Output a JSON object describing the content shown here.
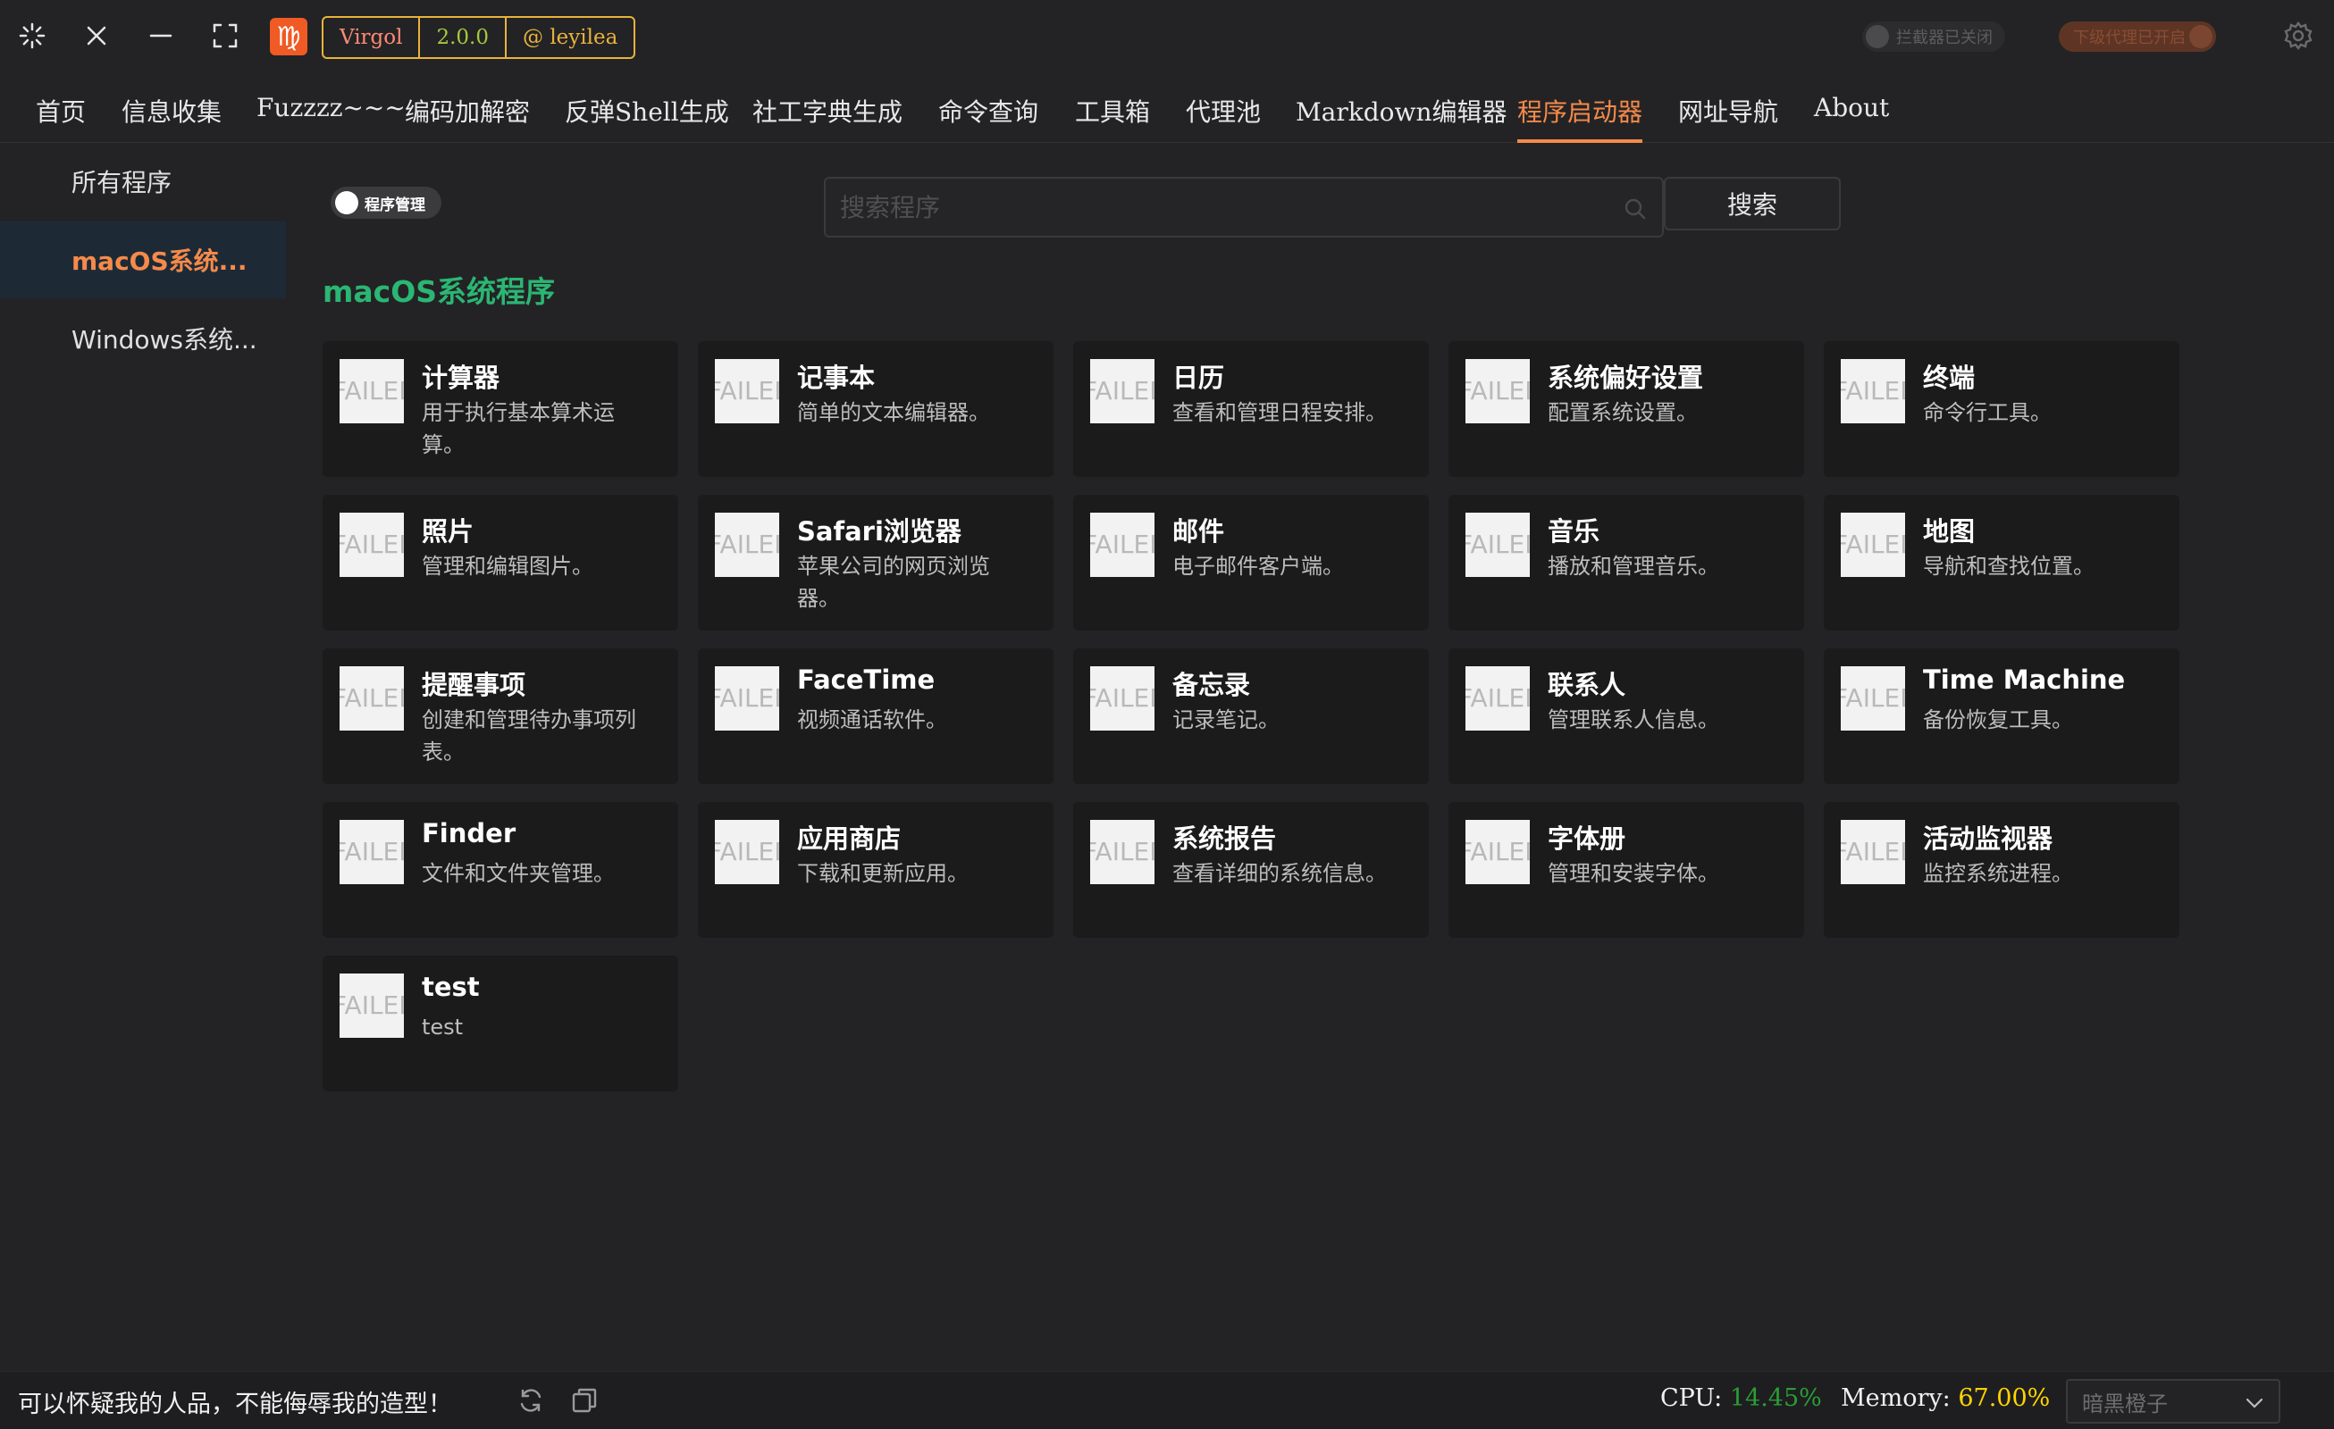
{
  "titlebar": {
    "logo_text": "♍",
    "badges": {
      "name": "Virgol",
      "version": "2.0.0",
      "author": "@ leyilea"
    },
    "interceptor_label": "拦截器已关闭",
    "proxy_label": "下级代理已开启"
  },
  "nav": {
    "tabs": [
      "首页",
      "信息收集",
      "Fuzzzz~~~",
      "编码加解密",
      "反弹Shell生成",
      "社工字典生成",
      "命令查询",
      "工具箱",
      "代理池",
      "Markdown编辑器",
      "程序启动器",
      "网址导航",
      "About"
    ],
    "active": "程序启动器"
  },
  "sidebar": {
    "items": [
      "所有程序",
      "macOS系统...",
      "Windows系统..."
    ],
    "active": "macOS系统..."
  },
  "toolbar": {
    "manage_label": "程序管理",
    "search_placeholder": "搜索程序",
    "search_button": "搜索"
  },
  "section": {
    "title": "macOS系统程序"
  },
  "image_fallback": "FAILED",
  "programs": [
    {
      "title": "计算器",
      "desc": "用于执行基本算术运算。"
    },
    {
      "title": "记事本",
      "desc": "简单的文本编辑器。"
    },
    {
      "title": "日历",
      "desc": "查看和管理日程安排。"
    },
    {
      "title": "系统偏好设置",
      "desc": "配置系统设置。"
    },
    {
      "title": "终端",
      "desc": "命令行工具。"
    },
    {
      "title": "照片",
      "desc": "管理和编辑图片。"
    },
    {
      "title": "Safari浏览器",
      "desc": "苹果公司的网页浏览器。"
    },
    {
      "title": "邮件",
      "desc": "电子邮件客户端。"
    },
    {
      "title": "音乐",
      "desc": "播放和管理音乐。"
    },
    {
      "title": "地图",
      "desc": "导航和查找位置。"
    },
    {
      "title": "提醒事项",
      "desc": "创建和管理待办事项列表。"
    },
    {
      "title": "FaceTime",
      "desc": "视频通话软件。"
    },
    {
      "title": "备忘录",
      "desc": "记录笔记。"
    },
    {
      "title": "联系人",
      "desc": "管理联系人信息。"
    },
    {
      "title": "Time Machine",
      "desc": "备份恢复工具。"
    },
    {
      "title": "Finder",
      "desc": "文件和文件夹管理。"
    },
    {
      "title": "应用商店",
      "desc": "下载和更新应用。"
    },
    {
      "title": "系统报告",
      "desc": "查看详细的系统信息。"
    },
    {
      "title": "字体册",
      "desc": "管理和安装字体。"
    },
    {
      "title": "活动监视器",
      "desc": "监控系统进程。"
    },
    {
      "title": "test",
      "desc": "test"
    }
  ],
  "status": {
    "quote": "可以怀疑我的人品，不能侮辱我的造型！",
    "cpu_label": "CPU:",
    "cpu_value": "14.45%",
    "mem_label": "Memory:",
    "mem_value": "67.00%",
    "theme": "暗黑橙子"
  },
  "colors": {
    "accent": "#f58a4a",
    "section_title": "#2bb673",
    "cpu": "#2a9d36",
    "memory": "#ffd400",
    "badge_border": "#e8b33c"
  }
}
